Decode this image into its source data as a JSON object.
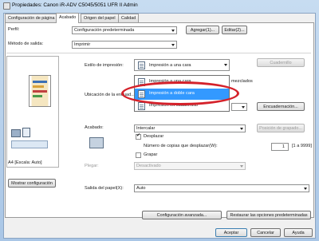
{
  "window": {
    "title": "Propiedades: Canon iR-ADV C5045/5051 UFR II Admin"
  },
  "tabs": [
    "Configuración de página",
    "Acabado",
    "Origen del papel",
    "Calidad"
  ],
  "profile": {
    "label": "Perfil:",
    "value": "Configuración predeterminada",
    "add_button": "Agregar(1)...",
    "edit_button": "Editar(2)..."
  },
  "output_method": {
    "label": "Método de salida:",
    "value": "Imprimir"
  },
  "print_style": {
    "label": "Estilo de impresión:",
    "value": "Impresión a una cara",
    "layout_button": "Cuadernillo"
  },
  "dropdown": {
    "items": [
      "Impresión a una cara",
      "Impresión a doble cara",
      "Impresión en cuadernillo"
    ],
    "selected_index": 1,
    "partial_right_text": "mezclados"
  },
  "binding_location": {
    "label": "Ubicación de la encuad...",
    "margin_button": "Encuadernación..."
  },
  "finishing": {
    "label": "Acabado:",
    "value": "Intercalar",
    "gutter_button": "Posición de grapado..."
  },
  "offset": {
    "label": "Desplazar",
    "copies_label": "Número de copias que desplazar(W):",
    "copies_value": "1",
    "copies_range": "[1 a 9999]"
  },
  "staple": {
    "label": "Grapar"
  },
  "fold": {
    "label": "Plegar:",
    "value": "Desactivado"
  },
  "preview": {
    "caption": "A4 [Escala: Auto]",
    "show_settings_button": "Mostrar configuración"
  },
  "paper_output": {
    "label": "Salida del papel(X):",
    "value": "Auto"
  },
  "bottom_buttons": {
    "advanced": "Configuración avanzada...",
    "restore": "Restaurar las opciones predeterminadas"
  },
  "dialog_buttons": {
    "ok": "Aceptar",
    "cancel": "Cancelar",
    "help": "Ayuda"
  },
  "colors": {
    "selection": "#3399ff",
    "highlight": "#d4212a"
  }
}
